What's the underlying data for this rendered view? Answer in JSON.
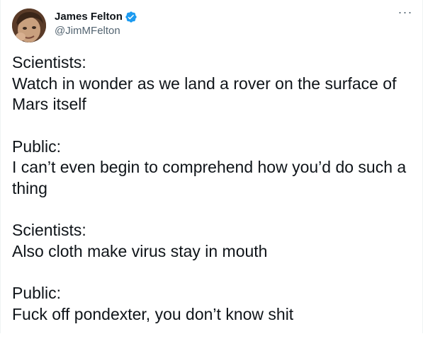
{
  "author": {
    "display_name": "James Felton",
    "handle": "@JimMFelton",
    "verified": true,
    "avatar_icon": "avatar-photo"
  },
  "menu": {
    "more_icon": "more-horizontal-icon",
    "glyph": "···"
  },
  "colors": {
    "verified_blue": "#1d9bf0",
    "text_primary": "#0f1419",
    "text_secondary": "#536471"
  },
  "tweet": {
    "paragraphs": [
      {
        "speaker": "Scientists:",
        "lines": [
          "Watch in wonder as we land a rover on the surface of",
          "Mars itself"
        ]
      },
      {
        "speaker": "Public:",
        "lines": [
          "I can’t even begin to comprehend how you’d do such a",
          "thing"
        ]
      },
      {
        "speaker": "Scientists:",
        "lines": [
          "Also cloth make virus stay in mouth"
        ]
      },
      {
        "speaker": "Public:",
        "lines": [
          "Fuck off pondexter, you don’t know shit"
        ]
      }
    ]
  }
}
